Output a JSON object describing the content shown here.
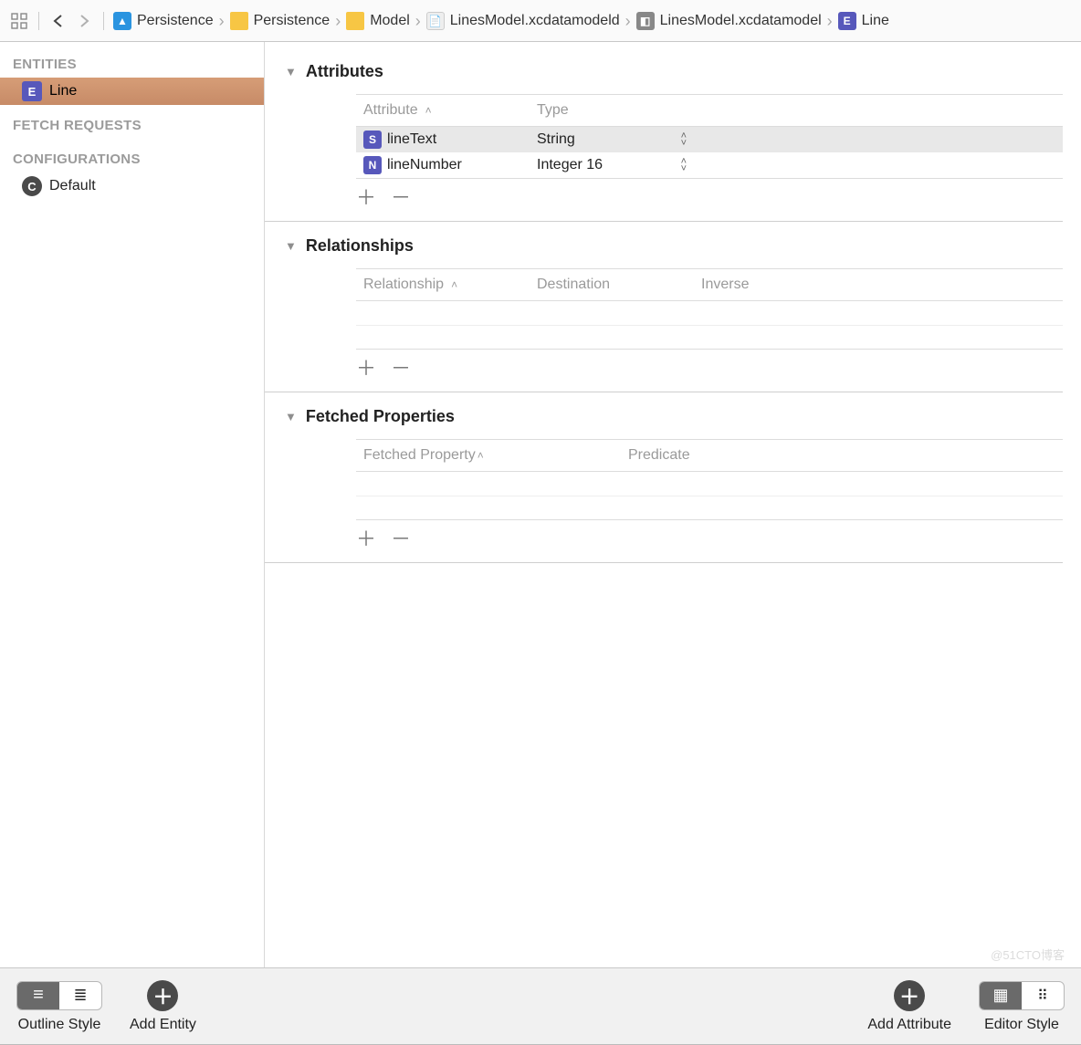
{
  "toolbar": {
    "crumbs": [
      {
        "icon": "blue",
        "label": "Persistence"
      },
      {
        "icon": "fold",
        "label": "Persistence"
      },
      {
        "icon": "fold",
        "label": "Model"
      },
      {
        "icon": "doc",
        "label": "LinesModel.xcdatamodeld"
      },
      {
        "icon": "db",
        "label": "LinesModel.xcdatamodel"
      },
      {
        "icon": "ent",
        "label": "Line"
      }
    ]
  },
  "sidebar": {
    "entities_header": "ENTITIES",
    "entities": [
      {
        "name": "Line",
        "selected": true
      }
    ],
    "fetch_header": "FETCH REQUESTS",
    "config_header": "CONFIGURATIONS",
    "configs": [
      {
        "name": "Default"
      }
    ]
  },
  "sections": {
    "attributes": {
      "title": "Attributes",
      "col_a": "Attribute",
      "col_b": "Type",
      "rows": [
        {
          "icon": "S",
          "name": "lineText",
          "type": "String",
          "selected": true
        },
        {
          "icon": "N",
          "name": "lineNumber",
          "type": "Integer 16",
          "selected": false
        }
      ]
    },
    "relationships": {
      "title": "Relationships",
      "col_a": "Relationship",
      "col_b": "Destination",
      "col_c": "Inverse",
      "rows": []
    },
    "fetched": {
      "title": "Fetched Properties",
      "col_a": "Fetched Property",
      "col_b": "Predicate",
      "rows": []
    }
  },
  "bottom": {
    "outline": "Outline Style",
    "add_entity": "Add Entity",
    "add_attr": "Add Attribute",
    "editor": "Editor Style"
  },
  "watermark": "@51CTO博客"
}
